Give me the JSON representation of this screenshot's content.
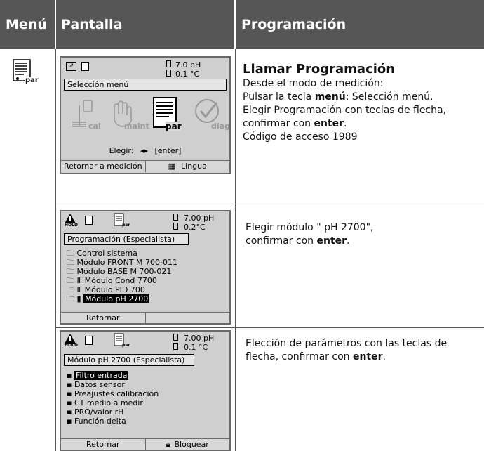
{
  "header": {
    "col1": "Menú",
    "col2": "Pantalla",
    "col3": "Programación"
  },
  "screen1": {
    "reading_ph": "7.0 pH",
    "reading_temp": "0.1 °C",
    "title": "Selección menú",
    "icon_labels": {
      "cal": "cal",
      "maint": "maint",
      "par": "par",
      "diag": "diag"
    },
    "choose": "Elegir:",
    "choose_keys": "[enter]",
    "softkey_left": "Retornar a medición",
    "softkey_right": "Lingua",
    "hold": ""
  },
  "screen2": {
    "hold": "HOLD",
    "par_label": "par",
    "reading_ph": "7.00 pH",
    "reading_temp": "0.2°C",
    "title": "Programación (Especialista)",
    "items": [
      "Control sistema",
      "Módulo FRONT M 700-011",
      "Módulo BASE M 700-021",
      "Módulo Cond 7700",
      "Módulo PID 700",
      "Módulo pH 2700"
    ],
    "softkey_left": "Retornar",
    "softkey_right": ""
  },
  "screen3": {
    "hold": "HOLD",
    "par_label": "par",
    "reading_ph": "7.00 pH",
    "reading_temp": "0.1 °C",
    "title": "Módulo pH 2700 (Especialista)",
    "items": [
      "Filtro entrada",
      "Datos sensor",
      "Preajustes calibración",
      "CT medio a medir",
      "PRO/valor rH",
      "Función delta"
    ],
    "softkey_left": "Retornar",
    "softkey_right": "Bloquear"
  },
  "text1": {
    "title": "Llamar Programación",
    "l1": "Desde el modo de medición:",
    "l2a": "Pulsar la tecla ",
    "l2b": "menú",
    "l2c": ": Selección menú.",
    "l3": "Elegir Programación con teclas de flecha,",
    "l4a": "confirmar con ",
    "l4b": "enter",
    "l4c": ".",
    "l5": "Código de acceso 1989"
  },
  "text2": {
    "l1": "Elegir módulo \" pH 2700\",",
    "l2a": "confirmar con ",
    "l2b": "enter",
    "l2c": "."
  },
  "text3": {
    "l1": "Elección de parámetros con las teclas de",
    "l2a": "flecha, confirmar con ",
    "l2b": "enter",
    "l2c": "."
  },
  "menu_icon_label": "par"
}
